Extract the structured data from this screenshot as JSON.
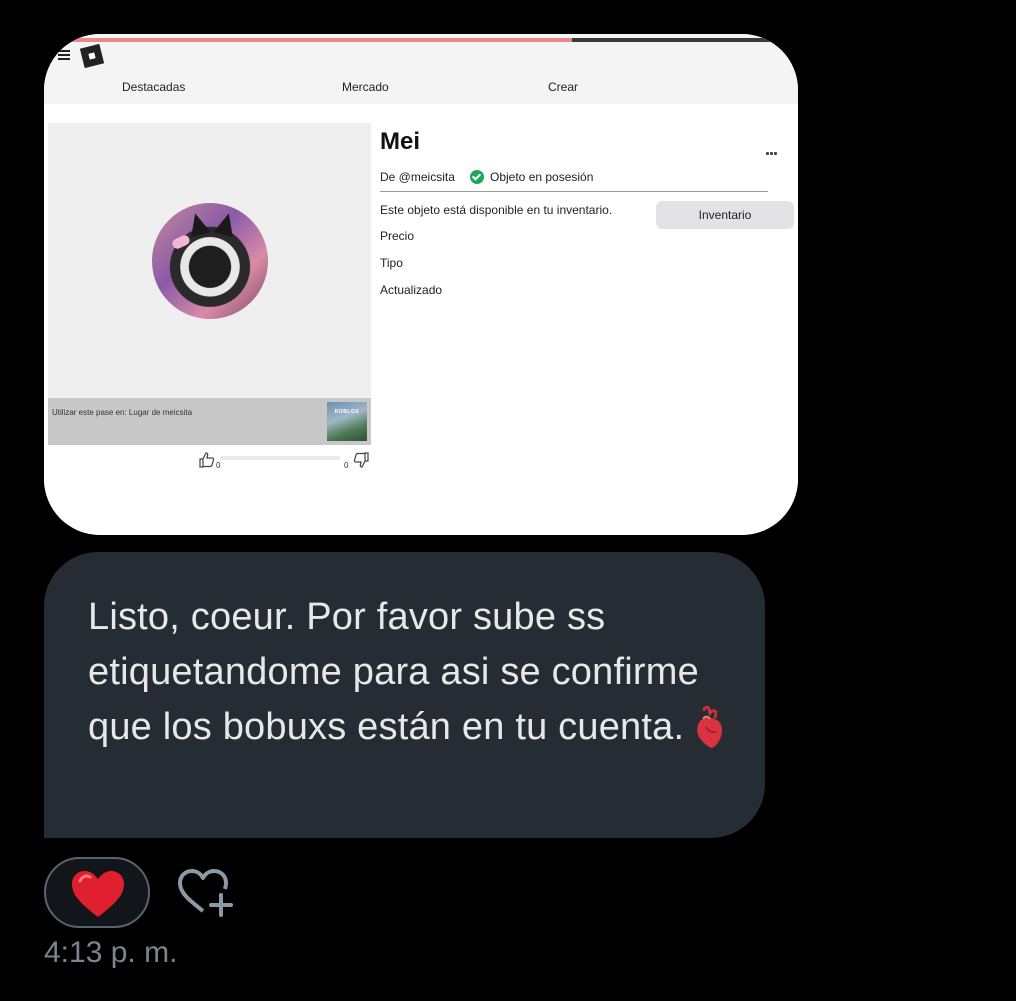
{
  "screenshot": {
    "progress_fraction": 0.7,
    "nav": [
      "Destacadas",
      "Mercado",
      "Crear"
    ],
    "item": {
      "title": "Mei",
      "creator": "De @meicsita",
      "owned_label": "Objeto en posesión",
      "availability": "Este objeto está disponible en tu inventario.",
      "inventory_button": "Inventario",
      "labels": [
        "Precio",
        "Tipo",
        "Actualizado"
      ]
    },
    "use_in": "Utilizar este pase en: Lugar de meicsita",
    "place_thumb_label": "ROBLOX",
    "votes": {
      "up": "0",
      "down": "0"
    }
  },
  "message": {
    "text": "Listo, coeur. Por favor sube ss etiquetandome para asi se confirme que los bobuxs están en tu cuenta.",
    "emoji": "anatomical-heart"
  },
  "reaction": {
    "emoji": "❤️",
    "emoji_name": "red-heart"
  },
  "timestamp": "4:13 p. m.",
  "colors": {
    "bubble": "#252c33",
    "bubble_text": "#e6e8ea",
    "timestamp": "#7c858d",
    "owned_check": "#1fa65a",
    "progress": "#e98a8a"
  }
}
